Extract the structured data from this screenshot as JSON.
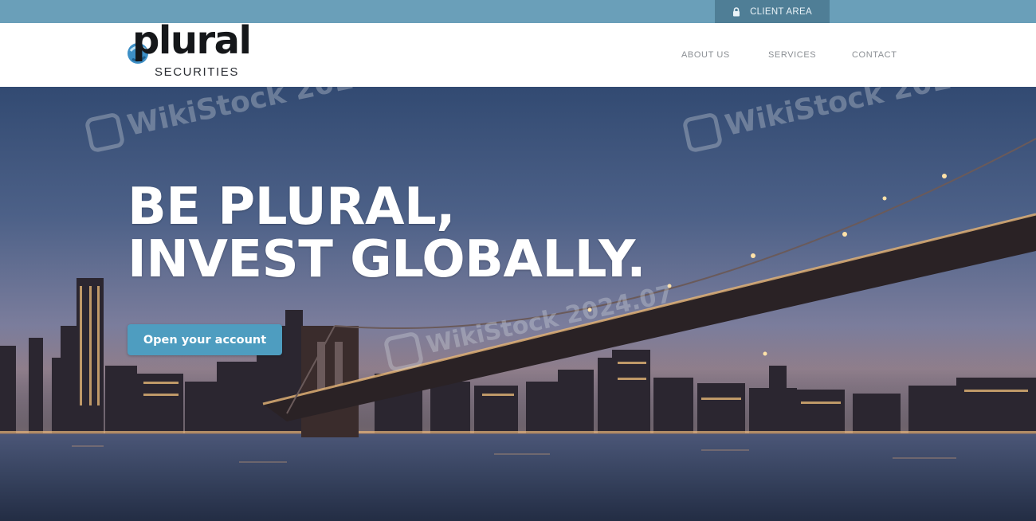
{
  "topbar": {
    "client_area_label": "CLIENT AREA",
    "client_area_icon": "lock-icon"
  },
  "header": {
    "logo_word": "plural",
    "logo_sub": "SECURITIES",
    "nav": [
      {
        "label": "ABOUT US"
      },
      {
        "label": "SERVICES"
      },
      {
        "label": "CONTACT"
      }
    ]
  },
  "hero": {
    "title_line1": "BE PLURAL,",
    "title_line2": "INVEST GLOBALLY.",
    "cta_label": "Open your account"
  },
  "watermark": {
    "text": "WikiStock 2024.07"
  },
  "colors": {
    "topbar": "#6a9fb9",
    "client_area_bg": "#4f7e96",
    "cta": "#4e9dc0",
    "nav_text": "#8b8f94"
  }
}
